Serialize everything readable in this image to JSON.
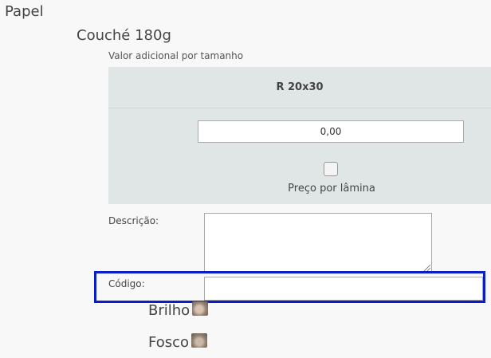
{
  "section": {
    "title": "Papel"
  },
  "paper": {
    "title": "Couché 180g",
    "additional_value_label": "Valor adicional por tamanho",
    "size_header": "R 20x30",
    "value": "0,00",
    "per_sheet_label": "Preço por lâmina",
    "per_sheet_checked": false
  },
  "form": {
    "description_label": "Descrição:",
    "description_value": "",
    "code_label": "Código:",
    "code_value": ""
  },
  "finishes": [
    {
      "label": "Brilho",
      "icon": "brilho-thumbnail-icon"
    },
    {
      "label": "Fosco",
      "icon": "fosco-thumbnail-icon"
    }
  ],
  "colors": {
    "highlight_border": "#0a1ec8",
    "panel_background": "#e0e6e6"
  }
}
